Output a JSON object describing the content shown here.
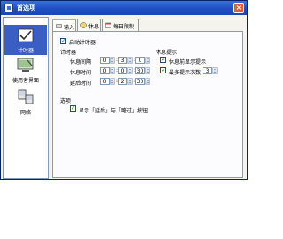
{
  "window": {
    "title": "首选项"
  },
  "sidebar": {
    "items": [
      {
        "label": "计时器"
      },
      {
        "label": "使用者界面"
      },
      {
        "label": "网络"
      }
    ]
  },
  "tabs": [
    {
      "label": "输入"
    },
    {
      "label": "休息"
    },
    {
      "label": "每日限制"
    }
  ],
  "panel": {
    "autostart_label": "启动计时器",
    "timer_header": "计时器",
    "rows": [
      {
        "label": "休息间隔",
        "h": "0",
        "m": "3",
        "s": "0"
      },
      {
        "label": "休息时间",
        "h": "0",
        "m": "0",
        "s": "30"
      },
      {
        "label": "延后时间",
        "h": "0",
        "m": "2",
        "s": "30"
      }
    ],
    "prompt_header": "休息提示",
    "show_before_label": "休息前显示提示",
    "max_prompts_label": "最多提示次数",
    "max_prompts_value": "3",
    "options_header": "选项",
    "skip_postpone_label": "显示「延后」与「略过」按钮"
  }
}
